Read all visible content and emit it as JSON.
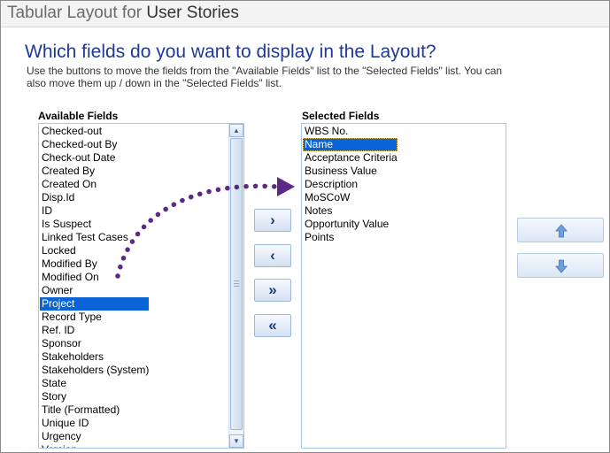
{
  "header": {
    "title_prefix": "Tabular Layout for ",
    "title_strong": "User Stories"
  },
  "question": "Which fields do you want to display in the Layout?",
  "help_text": "Use the buttons to move the fields from the \"Available Fields\" list to the \"Selected Fields\" list. You can also move them up / down in the \"Selected Fields\" list.",
  "available": {
    "label": "Available Fields",
    "selected_item": "Project",
    "items": [
      "Checked-out",
      "Checked-out By",
      "Check-out Date",
      "Created By",
      "Created On",
      "Disp.Id",
      "ID",
      "Is Suspect",
      "Linked Test Cases",
      "Locked",
      "Modified By",
      "Modified On",
      "Owner",
      "Project",
      "Record Type",
      "Ref. ID",
      "Sponsor",
      "Stakeholders",
      "Stakeholders (System)",
      "State",
      "Story",
      "Title (Formatted)",
      "Unique ID",
      "Urgency",
      "Version"
    ]
  },
  "selected": {
    "label": "Selected Fields",
    "selected_item": "Name",
    "items": [
      "WBS No.",
      "Name",
      "Acceptance Criteria",
      "Business Value",
      "Description",
      "MoSCoW",
      "Notes",
      "Opportunity Value",
      "Points"
    ]
  },
  "buttons": {
    "add": "›",
    "remove": "‹",
    "add_all": "»",
    "remove_all": "«"
  },
  "icons": {
    "scroll_up": "triangle-up",
    "scroll_down": "triangle-down",
    "move_up": "arrow-up",
    "move_down": "arrow-down",
    "annotation": "dotted-curved-arrow"
  },
  "colors": {
    "accent": "#1f3a93",
    "selection": "#0a64d6",
    "annotation": "#5b2a86"
  }
}
